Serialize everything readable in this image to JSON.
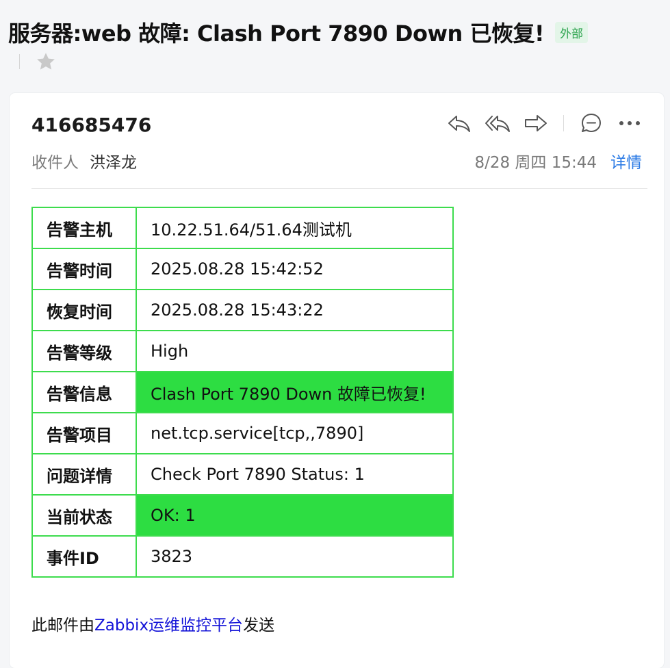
{
  "subject": "服务器:web 故障: Clash Port 7890 Down 已恢复!",
  "tag_external": "外部",
  "sender": "416685476",
  "recipient_label": "收件人",
  "recipient_name": "洪泽龙",
  "date": "8/28 周四 15:44",
  "details_label": "详情",
  "icons": {
    "reply": "reply-icon",
    "reply_all": "reply-all-icon",
    "forward": "forward-icon",
    "comment": "comment-icon",
    "more": "more-icon",
    "star": "star-icon"
  },
  "table": {
    "rows": [
      {
        "key": "告警主机",
        "value": "10.22.51.64/51.64测试机"
      },
      {
        "key": "告警时间",
        "value": "2025.08.28 15:42:52"
      },
      {
        "key": "恢复时间",
        "value": "2025.08.28 15:43:22"
      },
      {
        "key": "告警等级",
        "value": "High"
      },
      {
        "key": "告警信息",
        "value": "Clash Port 7890 Down 故障已恢复!"
      },
      {
        "key": "告警项目",
        "value": "net.tcp.service[tcp,,7890]"
      },
      {
        "key": "问题详情",
        "value": "Check Port 7890 Status: 1"
      },
      {
        "key": "当前状态",
        "value": "OK: 1"
      },
      {
        "key": "事件ID",
        "value": "3823"
      }
    ]
  },
  "footer": {
    "prefix": "此邮件由",
    "link": "Zabbix运维监控平台",
    "suffix": "发送"
  },
  "colors": {
    "table_border": "#3ddc4d",
    "highlight": "#2ddd42",
    "link": "#1414d8",
    "details_link": "#2c7be5",
    "tag_text": "#2ea44f",
    "tag_bg": "#e3f5e8"
  }
}
